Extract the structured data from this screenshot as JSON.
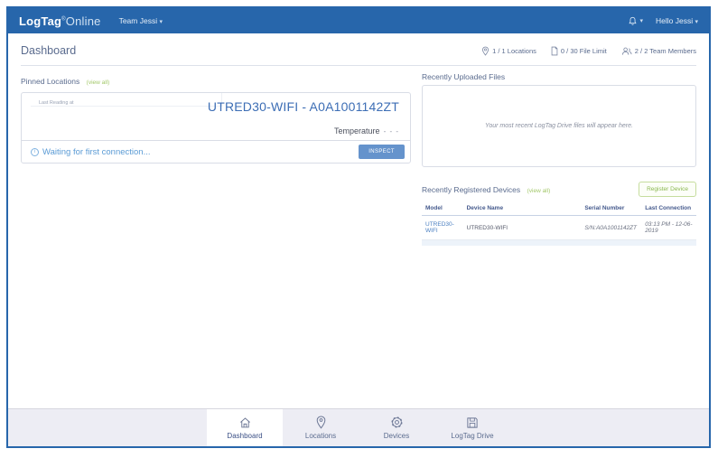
{
  "colors": {
    "navbar_blue": "#2766ab",
    "frame_blue": "#2766ab",
    "heading_gray_blue": "#5a6b8e",
    "link_blue": "#4a7fc1",
    "device_title_blue": "#3d6eb5",
    "inspect_button_blue": "#6593cc",
    "waiting_text_blue": "#5b9bd5",
    "view_all_green": "#a3c86a",
    "register_button_green": "#8ab84f",
    "bottom_bar_bg": "#ededf4"
  },
  "navbar": {
    "logo_bold": "LogTag",
    "logo_reg": "®",
    "logo_light": "Online",
    "team_label": "Team Jessi",
    "team_caret": "▾",
    "bell_icon": "bell-icon",
    "bell_caret": "▾",
    "user_label": "Hello Jessi",
    "user_caret": "▾"
  },
  "header": {
    "title": "Dashboard",
    "stats": [
      {
        "icon": "location-pin-icon",
        "label": "1 / 1 Locations"
      },
      {
        "icon": "file-icon",
        "label": "0 / 30 File Limit"
      },
      {
        "icon": "team-icon",
        "label": "2 / 2 Team Members"
      }
    ]
  },
  "pinned_locations": {
    "title": "Pinned Locations",
    "view_all": "(view all)",
    "card": {
      "last_reading_label": "Last Reading at",
      "device_title": "UTRED30-WIFI - A0A1001142ZT",
      "metric_label": "Temperature",
      "metric_value": "- - -",
      "status_icon": "info-icon",
      "status_text": "Waiting for first connection...",
      "inspect_label": "INSPECT"
    }
  },
  "recent_files": {
    "title": "Recently Uploaded Files",
    "empty_message": "Your most recent LogTag Drive files will appear here."
  },
  "recent_devices": {
    "title": "Recently Registered Devices",
    "view_all": "(view all)",
    "register_label": "Register Device",
    "columns": [
      "Model",
      "Device Name",
      "Serial Number",
      "Last Connection"
    ],
    "rows": [
      {
        "model": "UTRED30-WIFI",
        "device_name": "UTRED30-WIFI",
        "serial": "S/N:A0A1001142ZT",
        "last_connection": "03:13 PM - 12-06-2019"
      }
    ]
  },
  "bottom_nav": {
    "items": [
      {
        "icon": "home-icon",
        "label": "Dashboard",
        "active": true
      },
      {
        "icon": "location-pin-icon",
        "label": "Locations",
        "active": false
      },
      {
        "icon": "gear-icon",
        "label": "Devices",
        "active": false
      },
      {
        "icon": "drive-icon",
        "label": "LogTag Drive",
        "active": false
      }
    ]
  }
}
